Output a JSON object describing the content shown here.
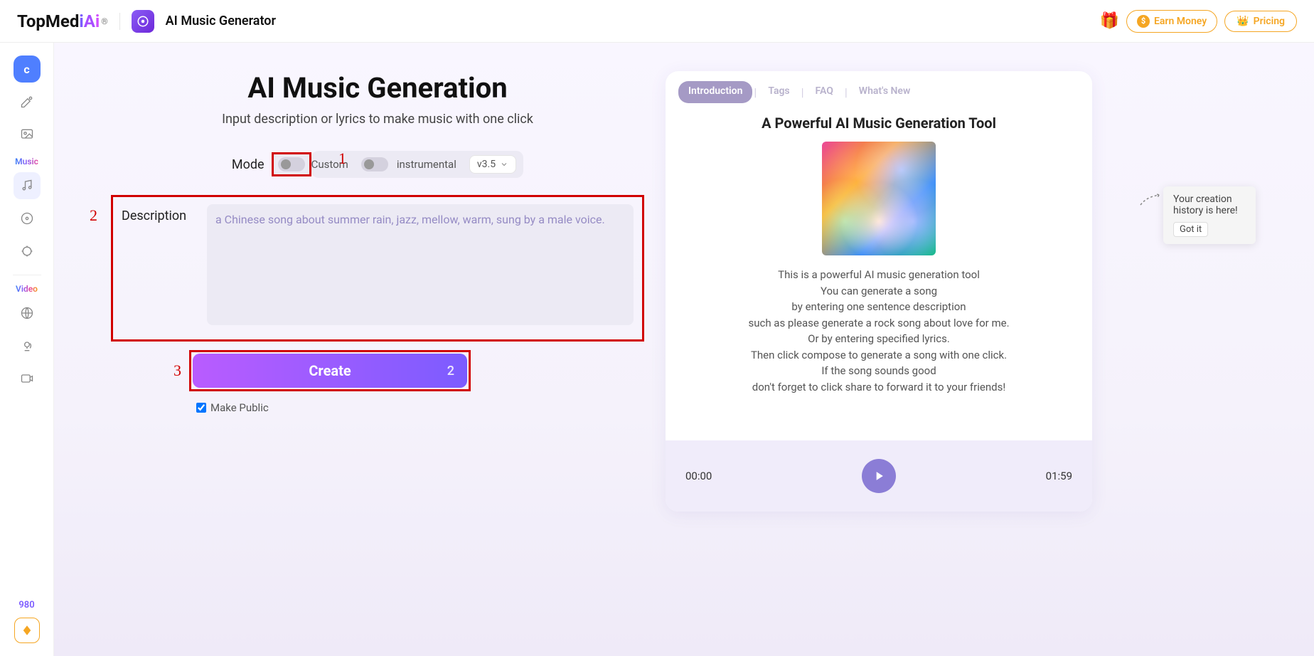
{
  "header": {
    "logo_text": "TopMediAi",
    "product_name": "AI Music Generator",
    "earn_label": "Earn Money",
    "pricing_label": "Pricing"
  },
  "sidebar": {
    "section_music": "Music",
    "section_video": "Video",
    "credits": "980"
  },
  "main": {
    "title": "AI Music Generation",
    "subtitle": "Input description or lyrics to make music with one click",
    "annotation_1": "1",
    "annotation_2": "2",
    "annotation_3": "3",
    "mode_label": "Mode",
    "custom_label": "Custom",
    "instrumental_label": "instrumental",
    "version": "v3.5",
    "description_label": "Description",
    "description_placeholder": "a Chinese song about summer rain, jazz, mellow, warm, sung by a male voice.",
    "create_label": "Create",
    "create_count": "2",
    "make_public_label": "Make Public",
    "make_public_checked": true
  },
  "info": {
    "tabs": [
      "Introduction",
      "Tags",
      "FAQ",
      "What's New"
    ],
    "active_tab": 0,
    "title": "A Powerful AI Music Generation Tool",
    "body_lines": [
      "This is a powerful AI music generation tool",
      "You can generate a song",
      "by entering one sentence description",
      "such as please generate a rock song about love for me.",
      "Or by entering specified lyrics.",
      "Then click compose to generate a song with one click.",
      "If the song sounds good",
      "don't forget to click share to forward it to your friends!"
    ],
    "time_start": "00:00",
    "time_end": "01:59"
  },
  "tooltip": {
    "line1": "Your creation",
    "line2": "history is here!",
    "gotit": "Got it"
  }
}
